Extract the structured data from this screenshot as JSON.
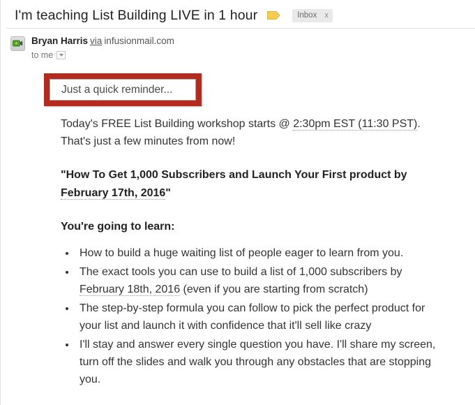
{
  "email": {
    "subject": "I'm teaching List Building LIVE in 1 hour",
    "label_icon": "label-flag-icon",
    "label_chip": {
      "name": "Inbox",
      "close": "x"
    },
    "sender": {
      "avatar_icon": "video-camera-icon",
      "name": "Bryan Harris",
      "via": "via",
      "domain": "infusionmail.com",
      "recipient": "to me",
      "details_caret": "chevron-down-icon"
    },
    "annotation": {
      "text": "Just a quick reminder...",
      "border_color": "#b52a1d"
    },
    "body": {
      "paragraph_1_part_1": "Today's FREE List Building workshop starts @ ",
      "paragraph_1_time": "2:30pm EST (11:30 PST)",
      "paragraph_1_part_2": ". That's just a few minutes from now!",
      "headline_part_1": "\"How To Get 1,000 Subscribers and Launch Your First product by ",
      "headline_date": "February 17th, 2016",
      "headline_part_2": "\"",
      "learn_heading": "You're going to learn:",
      "bullets": [
        {
          "text_1": "How to build a huge waiting list of people eager to learn from you.",
          "date": "",
          "text_2": ""
        },
        {
          "text_1": "The exact tools you can use to build a list of 1,000 subscribers by ",
          "date": "February 18th, 2016",
          "text_2": " (even if you are starting from scratch)"
        },
        {
          "text_1": "The step-by-step formula you can follow to pick the perfect product for your list and launch it with confidence that it'll sell like crazy",
          "date": "",
          "text_2": ""
        },
        {
          "text_1": "I'll stay and answer every single question you have. I'll share my screen, turn off the slides and walk you through any obstacles that are stopping you.",
          "date": "",
          "text_2": ""
        }
      ]
    }
  }
}
